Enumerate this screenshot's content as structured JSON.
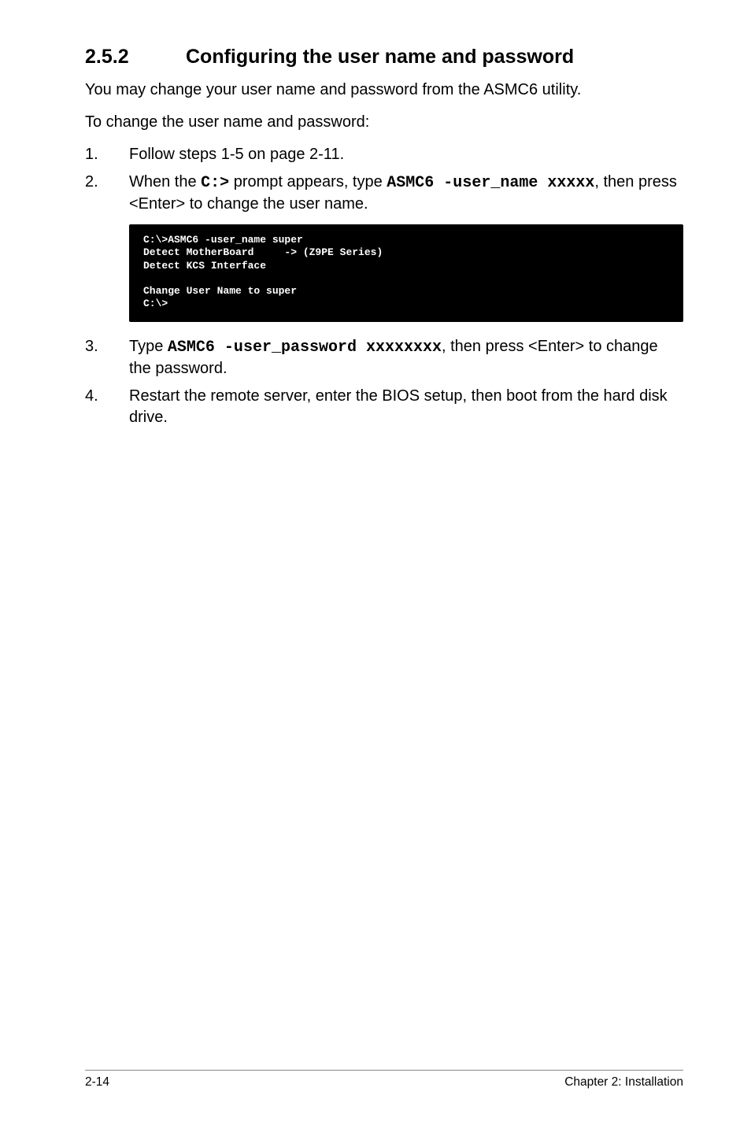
{
  "section": {
    "number": "2.5.2",
    "title": "Configuring the user name and password"
  },
  "intro": {
    "p1": "You may change your user name and password from the ASMC6 utility.",
    "p2": "To change the user name and password:"
  },
  "steps": {
    "s1": {
      "num": "1.",
      "text": "Follow steps 1-5 on page 2-11."
    },
    "s2": {
      "num": "2.",
      "pre": "When the ",
      "code1": "C:>",
      "mid": " prompt appears, type ",
      "code2": "ASMC6 -user_name xxxxx",
      "post": ", then press <Enter> to change the user name."
    },
    "s3": {
      "num": "3.",
      "pre": "Type ",
      "code1": "ASMC6 -user_password xxxxxxxx",
      "post": ", then press <Enter> to change the password."
    },
    "s4": {
      "num": "4.",
      "text": "Restart the remote server, enter the BIOS setup, then boot from the hard disk drive."
    }
  },
  "terminal": "C:\\>ASMC6 -user_name super\nDetect MotherBoard     -> (Z9PE Series)\nDetect KCS Interface\n\nChange User Name to super\nC:\\>",
  "footer": {
    "left": "2-14",
    "right": "Chapter 2: Installation"
  }
}
